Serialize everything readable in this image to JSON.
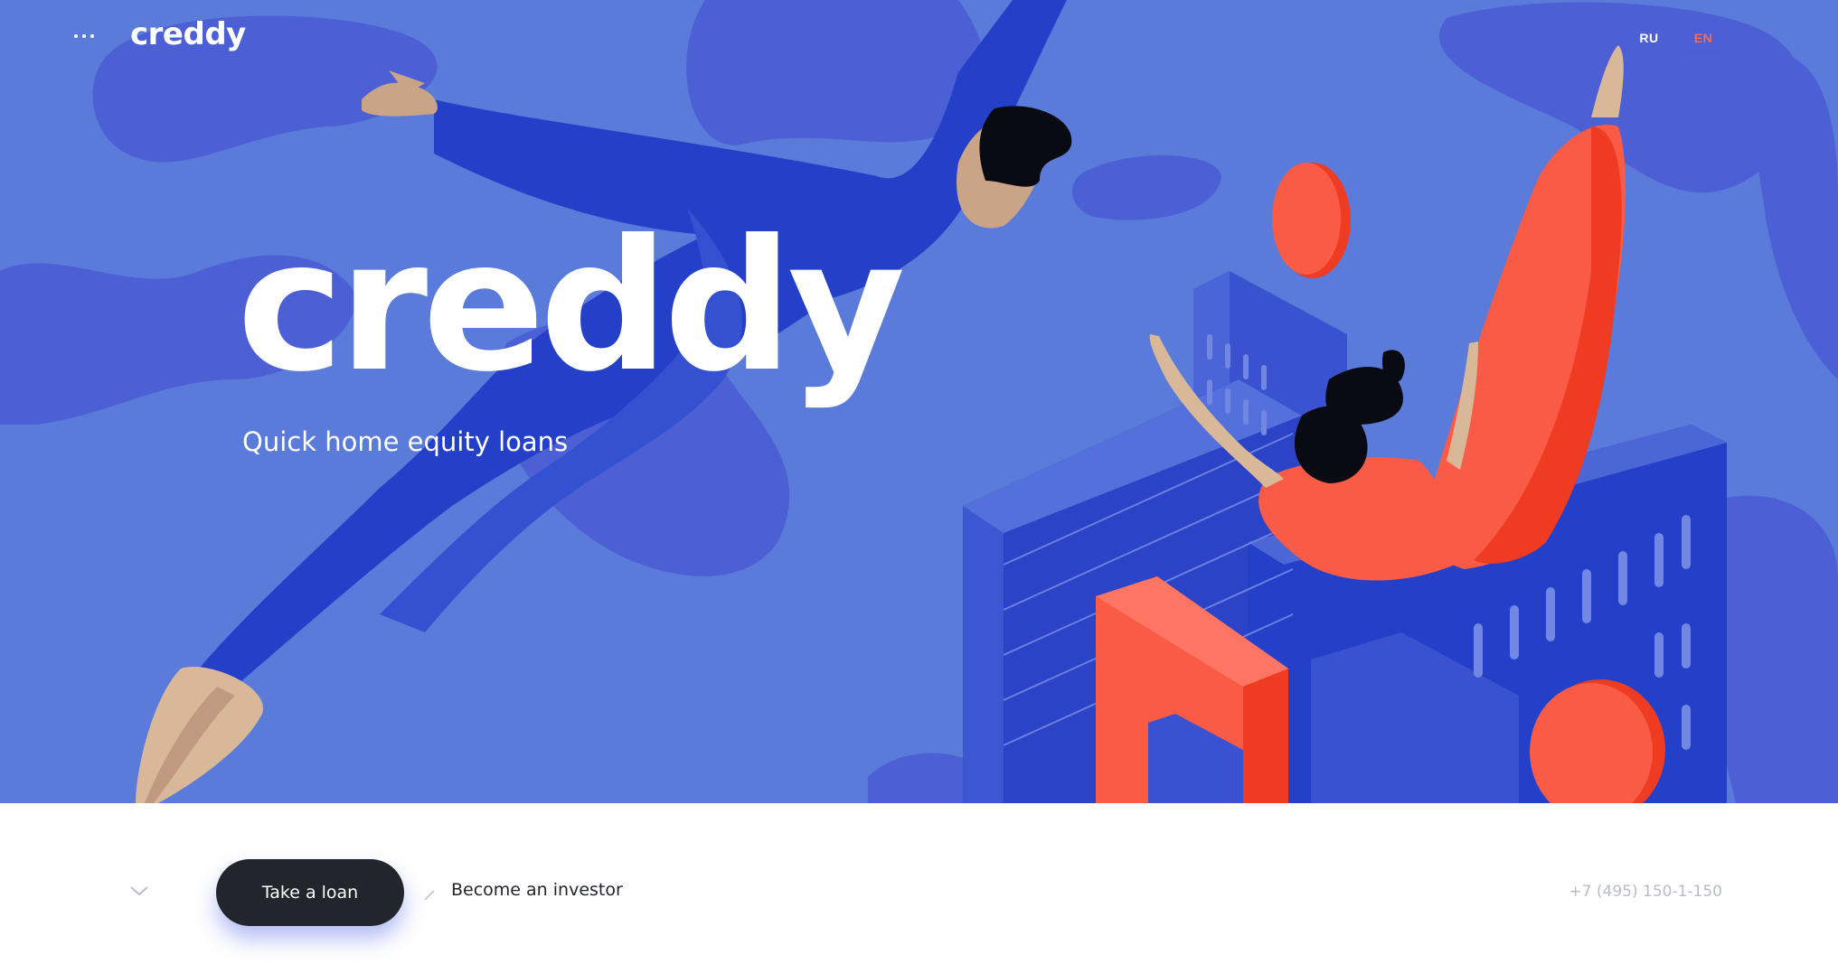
{
  "header": {
    "menu_icon": "more-dots-icon",
    "logo_text": "creddy",
    "languages": [
      {
        "label": "RU",
        "active": false
      },
      {
        "label": "EN",
        "active": true
      }
    ]
  },
  "hero": {
    "logo_text": "creddy",
    "tagline": "Quick home equity loans",
    "background_color": "#5a7bd9",
    "accent_color": "#fa5b46",
    "figure_color": "#2440c8"
  },
  "footer_bar": {
    "scroll_icon": "chevron-down-icon",
    "primary_button": "Take a loan",
    "separator_icon": "slash-icon",
    "secondary_link": "Become an investor",
    "phone": "+7 (495) 150-1-150"
  }
}
